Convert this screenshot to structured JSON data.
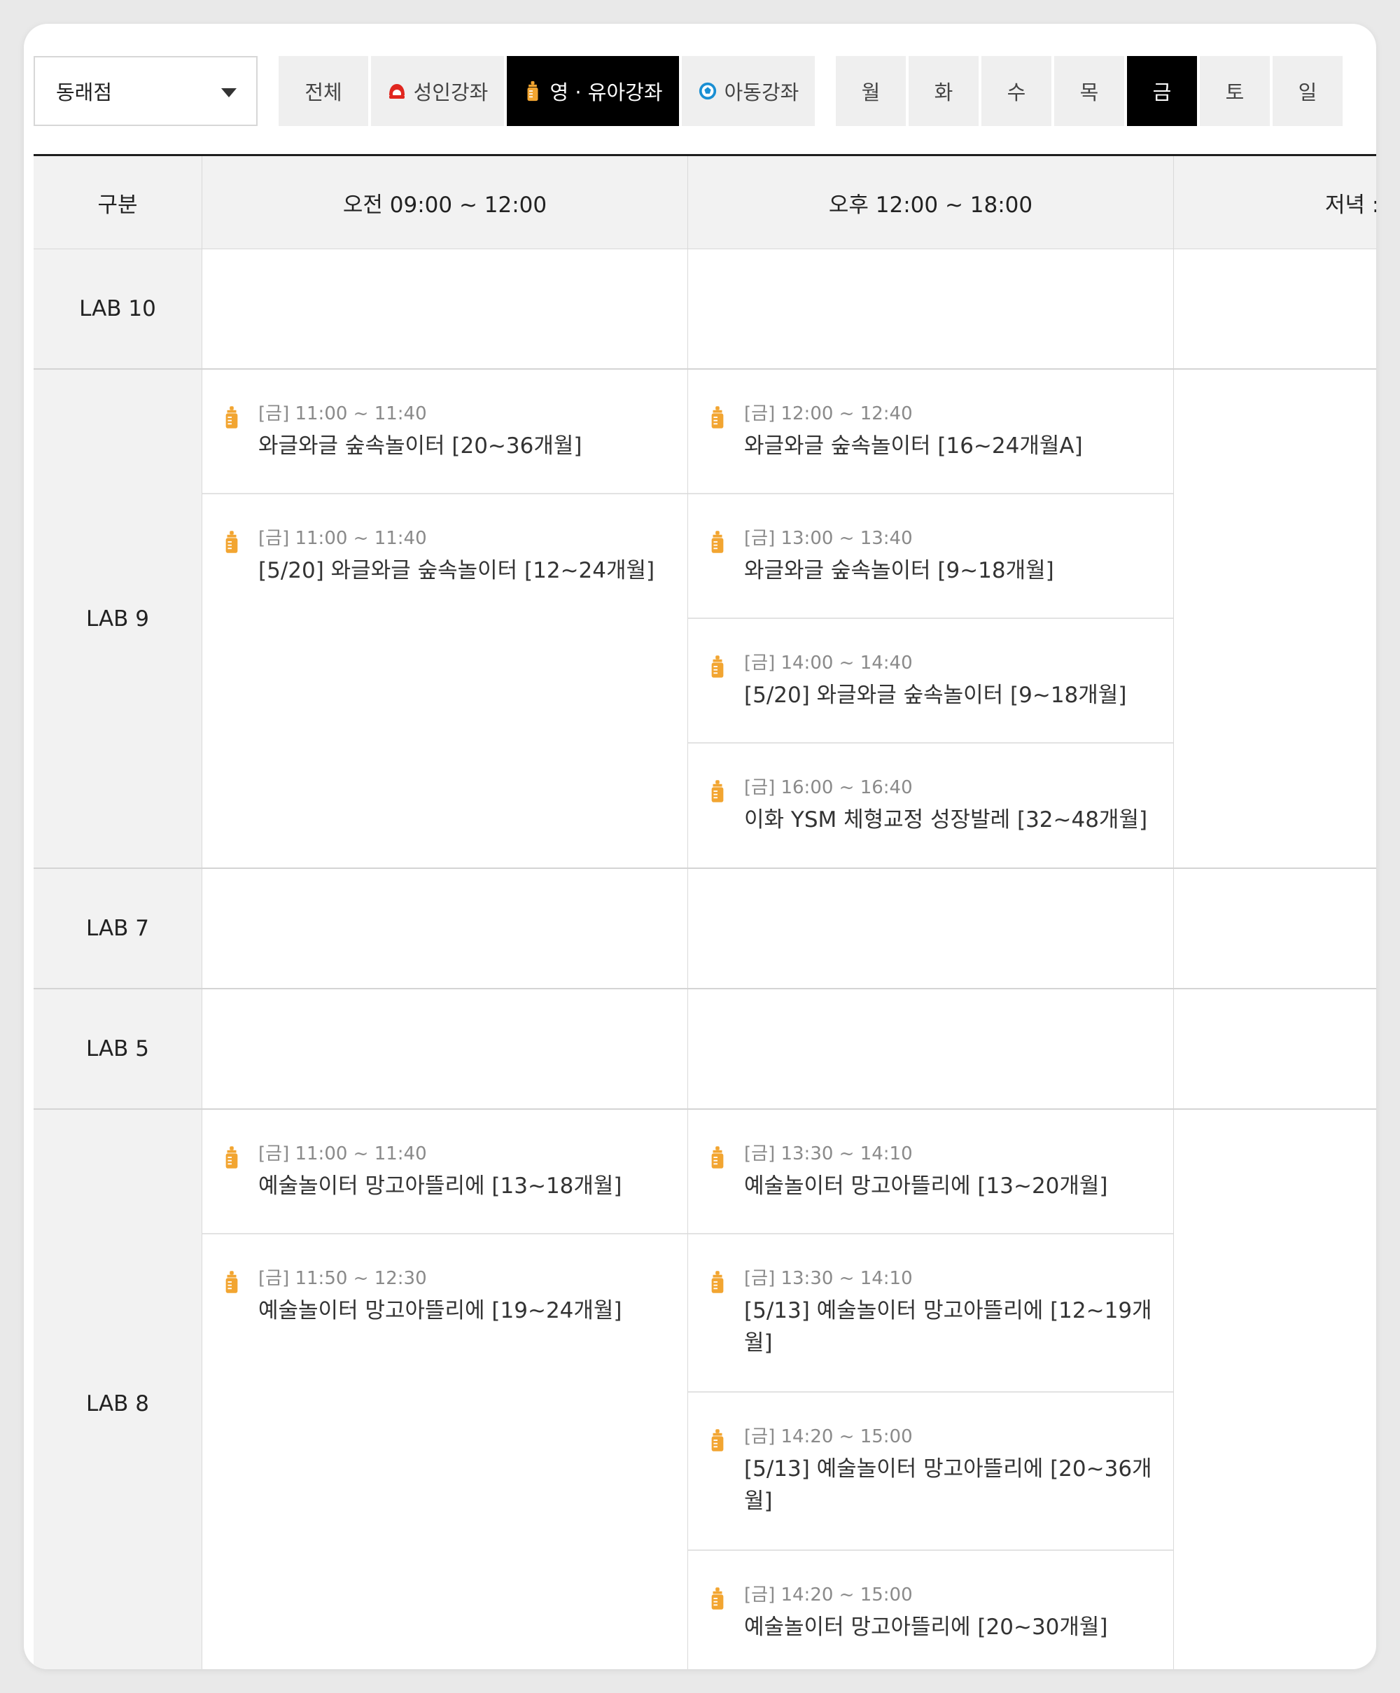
{
  "branch": {
    "selected": "동래점"
  },
  "categories": {
    "all": "전체",
    "adult": "성인강좌",
    "infant": "영 · 유아강좌",
    "kids": "아동강좌"
  },
  "days": [
    "월",
    "화",
    "수",
    "목",
    "금",
    "토",
    "일"
  ],
  "colors": {
    "accent_active": "#000000",
    "infant_icon": "#f2a531",
    "adult_icon": "#e0261f",
    "kids_icon": "#1a8fd3"
  },
  "table": {
    "headers": [
      "구분",
      "오전 09:00 ~ 12:00",
      "오후 12:00 ~ 18:00",
      "저녁 :"
    ],
    "rows": [
      {
        "lab": "LAB 10"
      },
      {
        "lab": "LAB 9",
        "am": [
          {
            "time": "[금] 11:00 ~ 11:40",
            "title": "와글와글 숲속놀이터 [20~36개월]"
          },
          {
            "time": "[금] 11:00 ~ 11:40",
            "title": "[5/20] 와글와글 숲속놀이터 [12~24개월]"
          }
        ],
        "pm": [
          {
            "time": "[금] 12:00 ~ 12:40",
            "title": "와글와글 숲속놀이터 [16~24개월A]"
          },
          {
            "time": "[금] 13:00 ~ 13:40",
            "title": "와글와글 숲속놀이터 [9~18개월]"
          },
          {
            "time": "[금] 14:00 ~ 14:40",
            "title": "[5/20] 와글와글 숲속놀이터 [9~18개월]"
          },
          {
            "time": "[금] 16:00 ~ 16:40",
            "title": "이화 YSM 체형교정 성장발레 [32~48개월]"
          }
        ]
      },
      {
        "lab": "LAB 7"
      },
      {
        "lab": "LAB 5"
      },
      {
        "lab": "LAB 8",
        "am": [
          {
            "time": "[금] 11:00 ~ 11:40",
            "title": "예술놀이터 망고아뜰리에 [13~18개월]"
          },
          {
            "time": "[금] 11:50 ~ 12:30",
            "title": "예술놀이터 망고아뜰리에 [19~24개월]"
          }
        ],
        "pm": [
          {
            "time": "[금] 13:30 ~ 14:10",
            "title": "예술놀이터 망고아뜰리에 [13~20개월]"
          },
          {
            "time": "[금] 13:30 ~ 14:10",
            "title": "[5/13] 예술놀이터 망고아뜰리에 [12~19개월]"
          },
          {
            "time": "[금] 14:20 ~ 15:00",
            "title": "[5/13] 예술놀이터 망고아뜰리에 [20~36개월]"
          },
          {
            "time": "[금] 14:20 ~ 15:00",
            "title": "예술놀이터 망고아뜰리에 [20~30개월]"
          }
        ]
      }
    ]
  }
}
